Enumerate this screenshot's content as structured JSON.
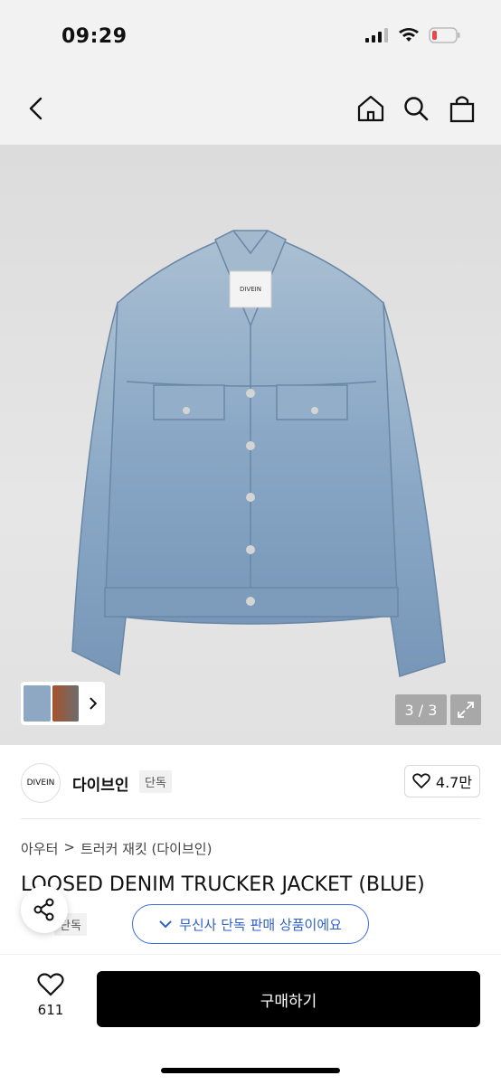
{
  "status": {
    "time": "09:29"
  },
  "nav": {
    "back_icon": "chevron-left-icon",
    "home_icon": "home-icon",
    "search_icon": "search-icon",
    "cart_icon": "bag-icon"
  },
  "gallery": {
    "counter": "3 / 3",
    "brand_tag": "DIVEIN"
  },
  "brand": {
    "logo": "DIVEIN",
    "name": "다이브인",
    "badge": "단독",
    "likes": "4.7만"
  },
  "breadcrumb": [
    "아우터",
    "트러커 재킷 (다이브인)"
  ],
  "product": {
    "title": "LOOSED DENIM TRUCKER JACKET (BLUE)",
    "tag": "단독"
  },
  "exclusive_notice": "무신사 단독 판매 상품이에요",
  "bottom": {
    "wish_count": "611",
    "buy_label": "구매하기"
  },
  "colors": {
    "accent_blue": "#2f61c9",
    "buy_bg": "#000000",
    "battery_red": "#e5484d"
  }
}
